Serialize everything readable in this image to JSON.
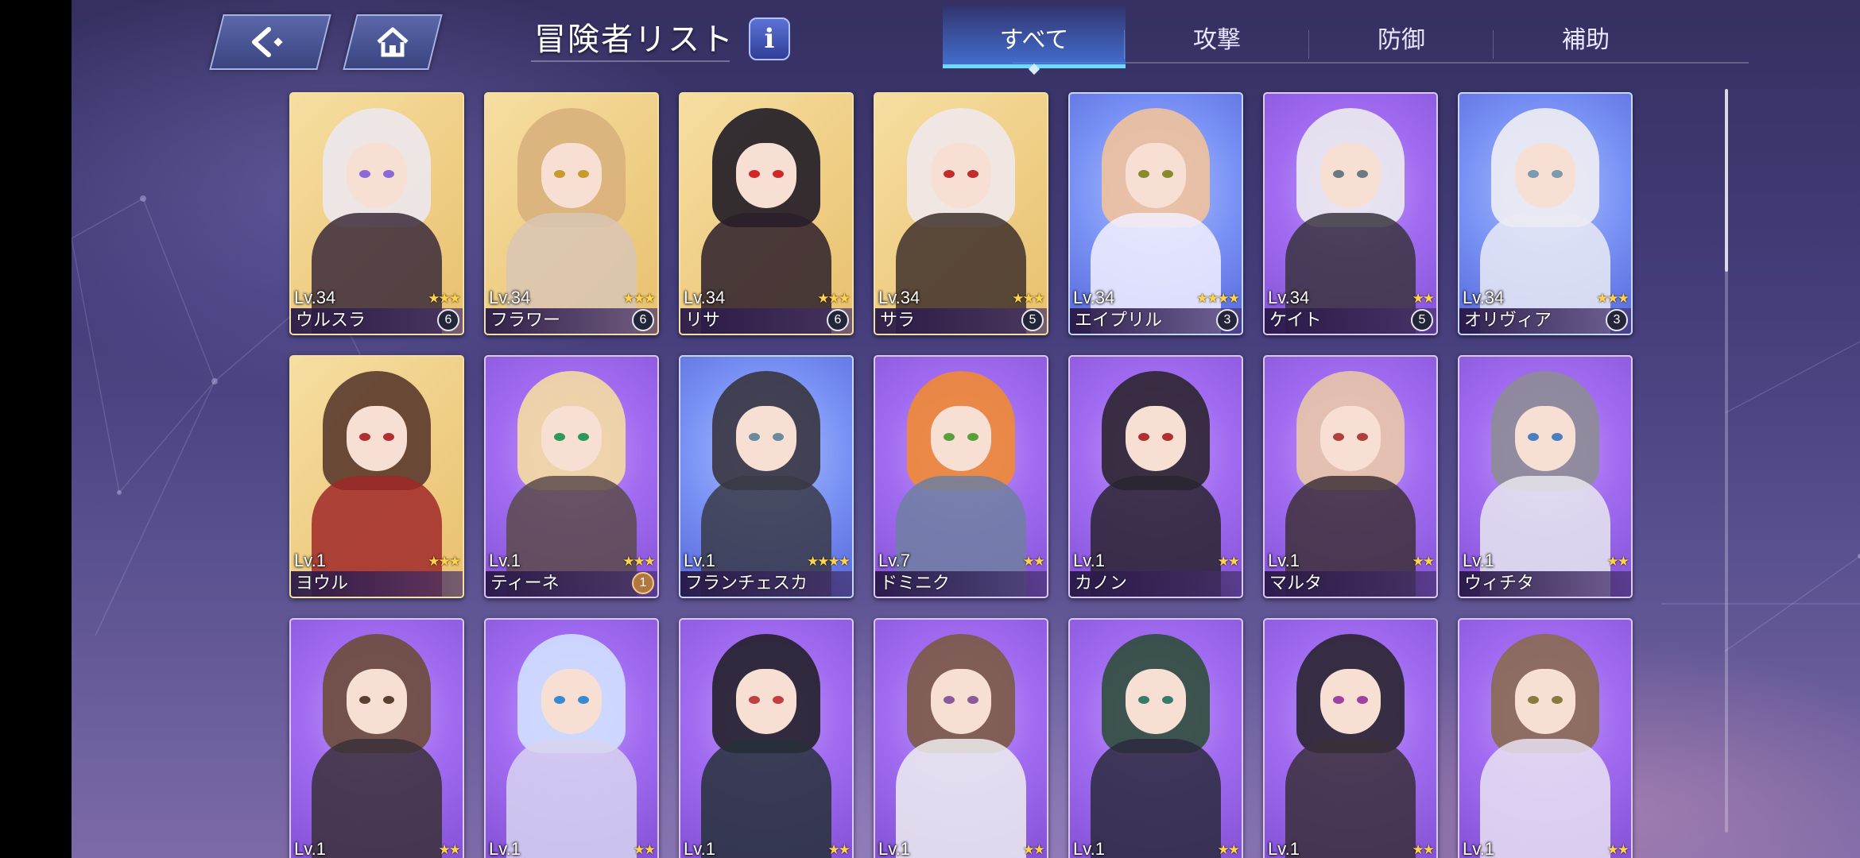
{
  "header": {
    "back_icon": "back-arrow-icon",
    "home_icon": "home-icon",
    "title": "冒険者リスト",
    "info_label": "i"
  },
  "tabs": [
    {
      "label": "すべて",
      "active": true
    },
    {
      "label": "攻撃",
      "active": false
    },
    {
      "label": "防御",
      "active": false
    },
    {
      "label": "補助",
      "active": false
    }
  ],
  "colors": {
    "gold_frame": "#e9c06e",
    "purple_frame": "#a06bf0",
    "blue_frame": "#7890f4",
    "active_tab": "#6fd9ff",
    "star": "#ffd34a"
  },
  "cards": [
    {
      "level": "Lv.34",
      "name": "ウルスラ",
      "stars": "★★★",
      "badge": "6",
      "frame": "gold"
    },
    {
      "level": "Lv.34",
      "name": "フラワー",
      "stars": "★★★",
      "badge": "6",
      "frame": "gold"
    },
    {
      "level": "Lv.34",
      "name": "リサ",
      "stars": "★★★",
      "badge": "6",
      "frame": "gold"
    },
    {
      "level": "Lv.34",
      "name": "サラ",
      "stars": "★★★",
      "badge": "5",
      "frame": "gold"
    },
    {
      "level": "Lv.34",
      "name": "エイプリル",
      "stars": "★★★★",
      "badge": "3",
      "frame": "blue"
    },
    {
      "level": "Lv.34",
      "name": "ケイト",
      "stars": "★★",
      "badge": "5",
      "frame": "purple"
    },
    {
      "level": "Lv.34",
      "name": "オリヴィア",
      "stars": "★★★",
      "badge": "3",
      "frame": "blue"
    },
    {
      "level": "Lv.1",
      "name": "ヨウル",
      "stars": "★★★",
      "badge": "",
      "frame": "gold"
    },
    {
      "level": "Lv.1",
      "name": "ティーネ",
      "stars": "★★★",
      "badge": "1",
      "frame": "purple"
    },
    {
      "level": "Lv.1",
      "name": "フランチェスカ",
      "stars": "★★★★",
      "badge": "",
      "frame": "blue"
    },
    {
      "level": "Lv.7",
      "name": "ドミニク",
      "stars": "★★",
      "badge": "",
      "frame": "purple"
    },
    {
      "level": "Lv.1",
      "name": "カノン",
      "stars": "★★",
      "badge": "",
      "frame": "purple"
    },
    {
      "level": "Lv.1",
      "name": "マルタ",
      "stars": "★★",
      "badge": "",
      "frame": "purple"
    },
    {
      "level": "Lv.1",
      "name": "ウィチタ",
      "stars": "★★",
      "badge": "",
      "frame": "purple"
    },
    {
      "level": "Lv.1",
      "name": "",
      "stars": "★★",
      "badge": "",
      "frame": "purple"
    },
    {
      "level": "Lv.1",
      "name": "",
      "stars": "★★",
      "badge": "",
      "frame": "purple"
    },
    {
      "level": "Lv.1",
      "name": "",
      "stars": "★★",
      "badge": "",
      "frame": "purple"
    },
    {
      "level": "Lv.1",
      "name": "",
      "stars": "★★",
      "badge": "",
      "frame": "purple"
    },
    {
      "level": "Lv.1",
      "name": "",
      "stars": "★★",
      "badge": "",
      "frame": "purple"
    },
    {
      "level": "Lv.1",
      "name": "",
      "stars": "★★",
      "badge": "",
      "frame": "purple"
    },
    {
      "level": "Lv.1",
      "name": "",
      "stars": "★★",
      "badge": "",
      "frame": "purple"
    }
  ]
}
